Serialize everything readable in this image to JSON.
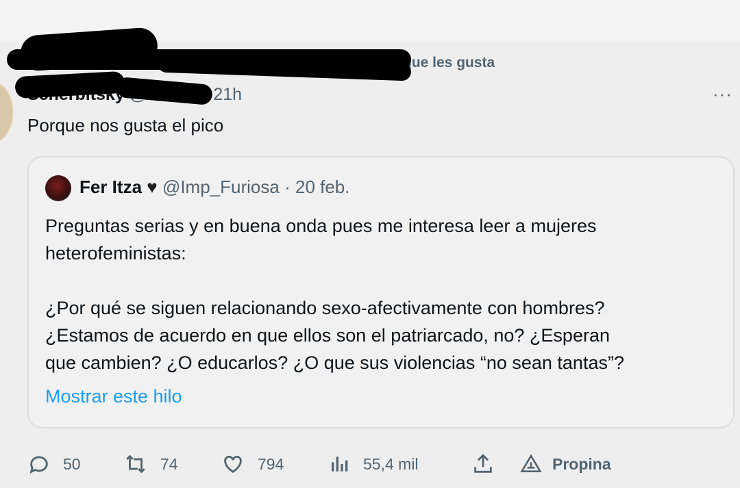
{
  "social_context": "que les gusta",
  "tweet": {
    "display_name": "Scherbitsky",
    "handle": "@na...ita",
    "time": "21h",
    "more": "···",
    "text": "Porque nos gusta el pico"
  },
  "quote": {
    "display_name": "Fer Itza",
    "heart": "♥",
    "handle": "@Imp_Furiosa",
    "date": "20 feb.",
    "paragraph1_line1": "Preguntas serias y en buena onda pues me interesa leer a mujeres",
    "paragraph1_line2": "heterofeministas:",
    "paragraph2_line1": "¿Por qué se siguen relacionando sexo-afectivamente con hombres?",
    "paragraph2_line2": "¿Estamos de acuerdo en que ellos son el patriarcado, no? ¿Esperan",
    "paragraph2_line3": "que cambien? ¿O educarlos? ¿O que sus violencias “no sean tantas”?",
    "show_thread": "Mostrar este hilo"
  },
  "actions": {
    "replies": "50",
    "retweets": "74",
    "likes": "794",
    "views": "55,4 mil",
    "tip": "Propina"
  },
  "icons": [
    "reply-icon",
    "retweet-icon",
    "like-icon",
    "views-icon",
    "share-icon",
    "tip-icon",
    "more-icon"
  ],
  "colors": {
    "link": "#1d9bf0",
    "secondary_text": "#536471",
    "primary_text": "#0f1419"
  }
}
